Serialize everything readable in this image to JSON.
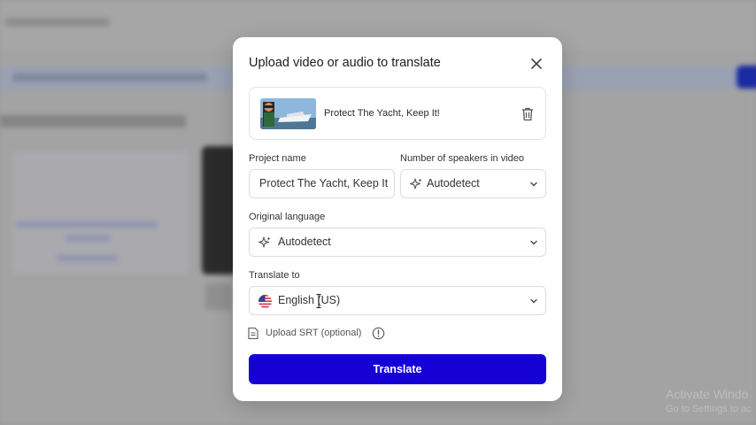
{
  "modal": {
    "title": "Upload video or audio to translate",
    "file": {
      "name": "Protect The Yacht, Keep It!"
    },
    "project_name": {
      "label": "Project name",
      "value": "Protect The Yacht, Keep It!"
    },
    "speakers": {
      "label": "Number of speakers in video",
      "value": "Autodetect"
    },
    "original_language": {
      "label": "Original language",
      "value": "Autodetect"
    },
    "translate_to": {
      "label": "Translate to",
      "value": "English (US)",
      "flag": "us-flag-icon"
    },
    "upload_srt": {
      "label": "Upload SRT (optional)"
    },
    "translate_button": "Translate"
  },
  "watermark": {
    "title": "Activate Windo",
    "subtitle": "Go to Settings to ac"
  },
  "colors": {
    "primary": "#1500d6",
    "overlay": "#9a9a9a"
  }
}
